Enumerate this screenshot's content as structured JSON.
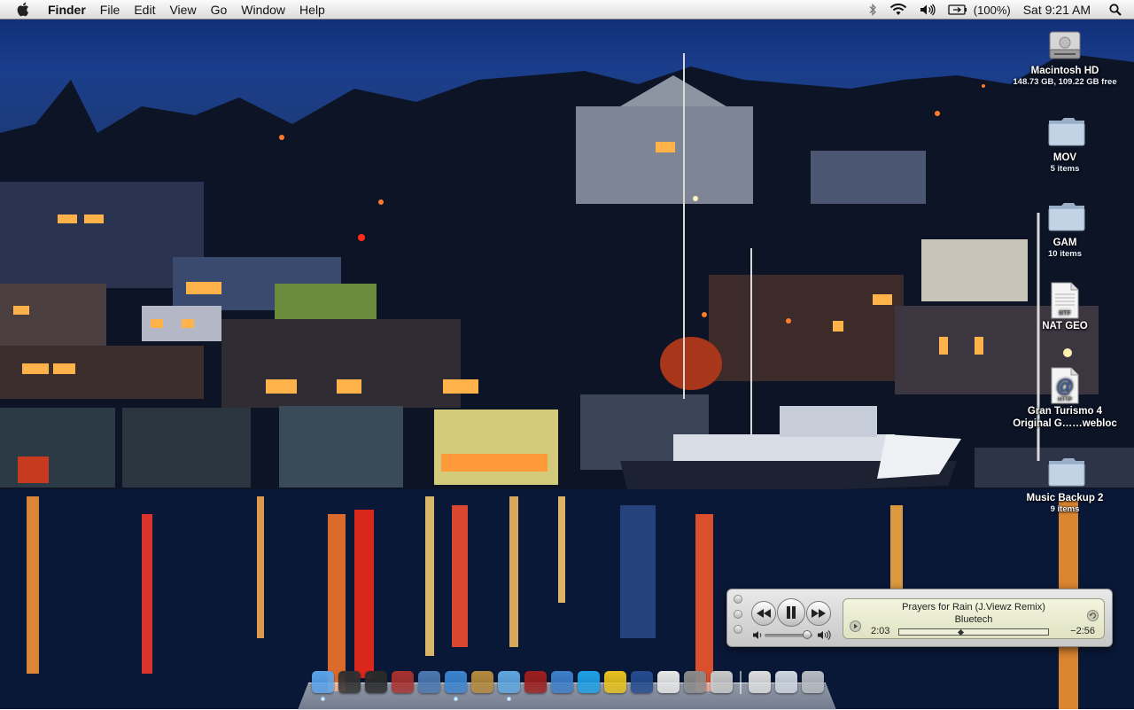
{
  "menubar": {
    "apple_icon": "apple-icon",
    "app_name": "Finder",
    "menus": [
      "File",
      "Edit",
      "View",
      "Go",
      "Window",
      "Help"
    ],
    "status": {
      "bluetooth_icon": "bluetooth-icon",
      "wifi_icon": "wifi-icon",
      "volume_icon": "speaker-icon",
      "battery_icon": "battery-icon",
      "battery_text": "(100%)",
      "clock": "Sat 9:21 AM",
      "spotlight_icon": "spotlight-icon"
    }
  },
  "desktop_icons": [
    {
      "label": "Macintosh HD",
      "sub": "148.73 GB, 109.22 GB free",
      "icon": "hard-drive-icon"
    },
    {
      "label": "MOV",
      "sub": "5 items",
      "icon": "folder-icon"
    },
    {
      "label": "GAM",
      "sub": "10 items",
      "icon": "folder-icon"
    },
    {
      "label": "NAT GEO",
      "sub": "",
      "icon": "rtf-document-icon",
      "badge": "RTF"
    },
    {
      "label": "Gran Turismo 4",
      "label2": "Original G……webloc",
      "icon": "webloc-icon",
      "badge": "HTTP"
    },
    {
      "label": "Music Backup 2",
      "sub": "9 items",
      "icon": "folder-icon"
    }
  ],
  "mini_player": {
    "song_title": "Prayers for Rain (J.Viewz Remix)",
    "artist": "Bluetech",
    "elapsed": "2:03",
    "remaining": "−2:56",
    "progress": 0.41,
    "volume": 0.88,
    "buttons": [
      "previous-track",
      "pause",
      "next-track"
    ]
  },
  "dock": {
    "apps": [
      {
        "name": "finder",
        "color": "#5aa3ea"
      },
      {
        "name": "dashboard",
        "color": "#303030"
      },
      {
        "name": "time-machine",
        "color": "#2a2a2a"
      },
      {
        "name": "dictionary",
        "color": "#a8322e"
      },
      {
        "name": "preview",
        "color": "#4a78b0"
      },
      {
        "name": "safari",
        "color": "#3b84cf"
      },
      {
        "name": "iphoto",
        "color": "#b58a3c"
      },
      {
        "name": "itunes",
        "color": "#5fa6df"
      },
      {
        "name": "photo-booth",
        "color": "#9c1e1e"
      },
      {
        "name": "facetime-video",
        "color": "#3d7ec9"
      },
      {
        "name": "skype",
        "color": "#1ea0e4"
      },
      {
        "name": "adium",
        "color": "#e8c21c"
      },
      {
        "name": "google-earth",
        "color": "#234b8e"
      },
      {
        "name": "textedit",
        "color": "#e8e8e8"
      },
      {
        "name": "system-preferences",
        "color": "#8a8a8a"
      },
      {
        "name": "activity-monitor",
        "color": "#c9c9c9"
      }
    ],
    "stacks": [
      {
        "name": "documents-stack",
        "color": "#dddddd"
      },
      {
        "name": "downloads-stack",
        "color": "#cfd6e0"
      },
      {
        "name": "trash",
        "color": "#b7bcc2"
      }
    ]
  }
}
